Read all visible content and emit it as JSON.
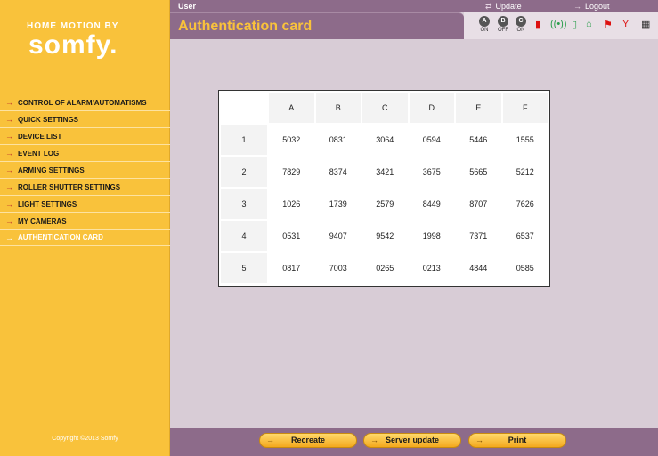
{
  "brand": {
    "top": "HOME MOTION BY",
    "logo": "somfy."
  },
  "sidebar": {
    "items": [
      {
        "label": "CONTROL OF ALARM/AUTOMATISMS"
      },
      {
        "label": "QUICK SETTINGS"
      },
      {
        "label": "DEVICE LIST"
      },
      {
        "label": "EVENT LOG"
      },
      {
        "label": "ARMING SETTINGS"
      },
      {
        "label": "ROLLER SHUTTER SETTINGS"
      },
      {
        "label": "LIGHT SETTINGS"
      },
      {
        "label": "MY CAMERAS"
      },
      {
        "label": "AUTHENTICATION CARD",
        "active": true
      }
    ],
    "copyright": "Copyright ©2013 Somfy"
  },
  "topbar": {
    "user": "User",
    "update": "Update",
    "logout": "Logout"
  },
  "title": "Authentication card",
  "status": {
    "modes": [
      {
        "letter": "A",
        "state": "ON"
      },
      {
        "letter": "B",
        "state": "OFF"
      },
      {
        "letter": "C",
        "state": "ON"
      }
    ],
    "icons": [
      "battery-icon",
      "signal-icon",
      "device-icon",
      "home-icon",
      "flag-icon",
      "antenna-icon",
      "calendar-icon"
    ]
  },
  "card": {
    "columns": [
      "A",
      "B",
      "C",
      "D",
      "E",
      "F"
    ],
    "rows": [
      {
        "label": "1",
        "cells": [
          "5032",
          "0831",
          "3064",
          "0594",
          "5446",
          "1555"
        ]
      },
      {
        "label": "2",
        "cells": [
          "7829",
          "8374",
          "3421",
          "3675",
          "5665",
          "5212"
        ]
      },
      {
        "label": "3",
        "cells": [
          "1026",
          "1739",
          "2579",
          "8449",
          "8707",
          "7626"
        ]
      },
      {
        "label": "4",
        "cells": [
          "0531",
          "9407",
          "9542",
          "1998",
          "7371",
          "6537"
        ]
      },
      {
        "label": "5",
        "cells": [
          "0817",
          "7003",
          "0265",
          "0213",
          "4844",
          "0585"
        ]
      }
    ]
  },
  "buttons": {
    "recreate": "Recreate",
    "server_update": "Server update",
    "print": "Print"
  },
  "colors": {
    "accent": "#f9c23b",
    "header": "#8d6b8a",
    "background": "#d8ccd6"
  }
}
